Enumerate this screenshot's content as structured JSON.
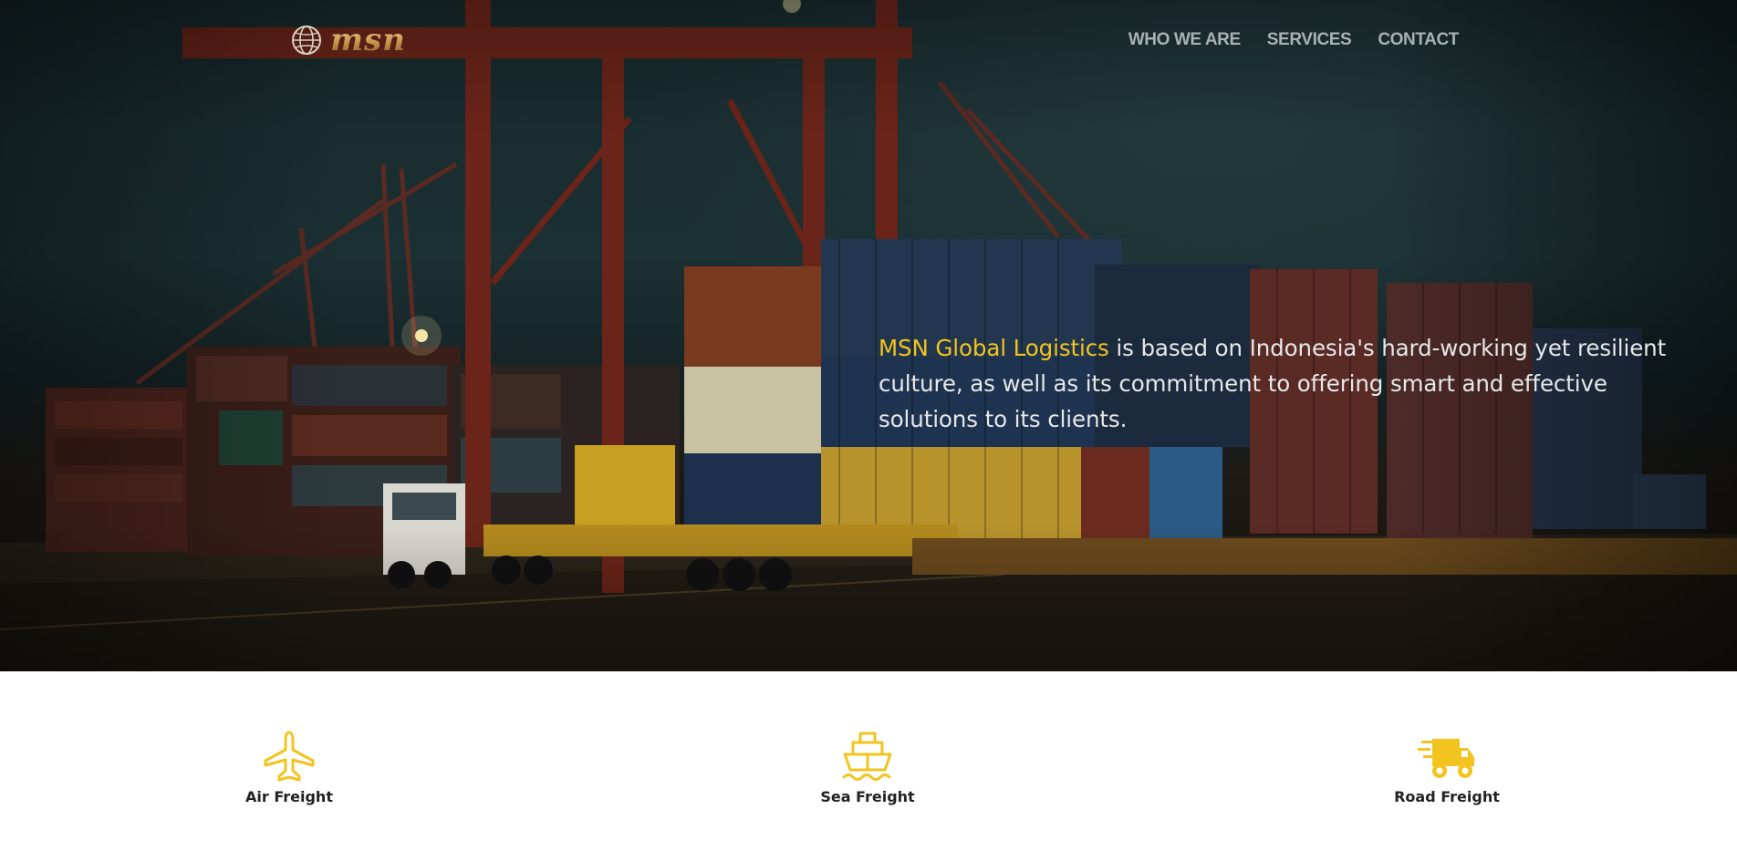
{
  "header": {
    "logo_text": "msn",
    "nav": [
      {
        "label": "WHO WE ARE"
      },
      {
        "label": "SERVICES"
      },
      {
        "label": "CONTACT"
      }
    ]
  },
  "hero": {
    "brand": "MSN Global Logistics",
    "text": " is based on Indonesia's hard-working yet resilient culture, as well as its commitment to offering smart and effective solutions to its clients."
  },
  "services": [
    {
      "label": "Air Freight",
      "icon": "airplane-icon"
    },
    {
      "label": "Sea Freight",
      "icon": "ship-icon"
    },
    {
      "label": "Road Freight",
      "icon": "truck-icon"
    }
  ],
  "colors": {
    "accent": "#f3c41f",
    "nav_text": "#a8b2b4",
    "hero_text": "#e6e8e8",
    "service_label": "#222222"
  }
}
